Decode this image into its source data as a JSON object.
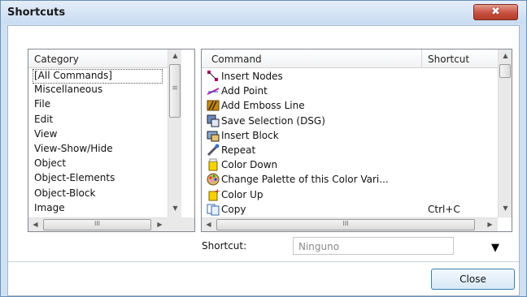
{
  "window": {
    "title": "Shortcuts",
    "close_glyph": "✖"
  },
  "category_panel": {
    "header": "Category",
    "items": [
      "[All Commands]",
      "Miscellaneous",
      "File",
      "Edit",
      "View",
      "View-Show/Hide",
      "Object",
      "Object-Elements",
      "Object-Block",
      "Image"
    ],
    "selected_index": 0
  },
  "command_panel": {
    "headers": {
      "command": "Command",
      "shortcut": "Shortcut"
    },
    "rows": [
      {
        "command": "Insert Nodes",
        "shortcut": "",
        "icon": "insert-nodes-icon"
      },
      {
        "command": "Add Point",
        "shortcut": "",
        "icon": "add-point-icon"
      },
      {
        "command": "Add Emboss Line",
        "shortcut": "",
        "icon": "emboss-line-icon"
      },
      {
        "command": "Save Selection (DSG)",
        "shortcut": "",
        "icon": "save-selection-icon"
      },
      {
        "command": "Insert Block",
        "shortcut": "",
        "icon": "insert-block-icon"
      },
      {
        "command": "Repeat",
        "shortcut": "",
        "icon": "repeat-icon"
      },
      {
        "command": "Color Down",
        "shortcut": "",
        "icon": "color-down-icon"
      },
      {
        "command": "Change Palette of this Color Vari...",
        "shortcut": "",
        "icon": "palette-icon"
      },
      {
        "command": "Color Up",
        "shortcut": "",
        "icon": "color-up-icon"
      },
      {
        "command": "Copy",
        "shortcut": "Ctrl+C",
        "icon": "copy-icon"
      }
    ],
    "hscroll_grip": "III"
  },
  "shortcut": {
    "label": "Shortcut:",
    "value": "Ninguno",
    "menu_glyph": "▼"
  },
  "footer": {
    "close_label": "Close"
  },
  "scroll_glyphs": {
    "up": "▲",
    "down": "▼",
    "left": "◀",
    "right": "▶",
    "grip": "≡"
  }
}
